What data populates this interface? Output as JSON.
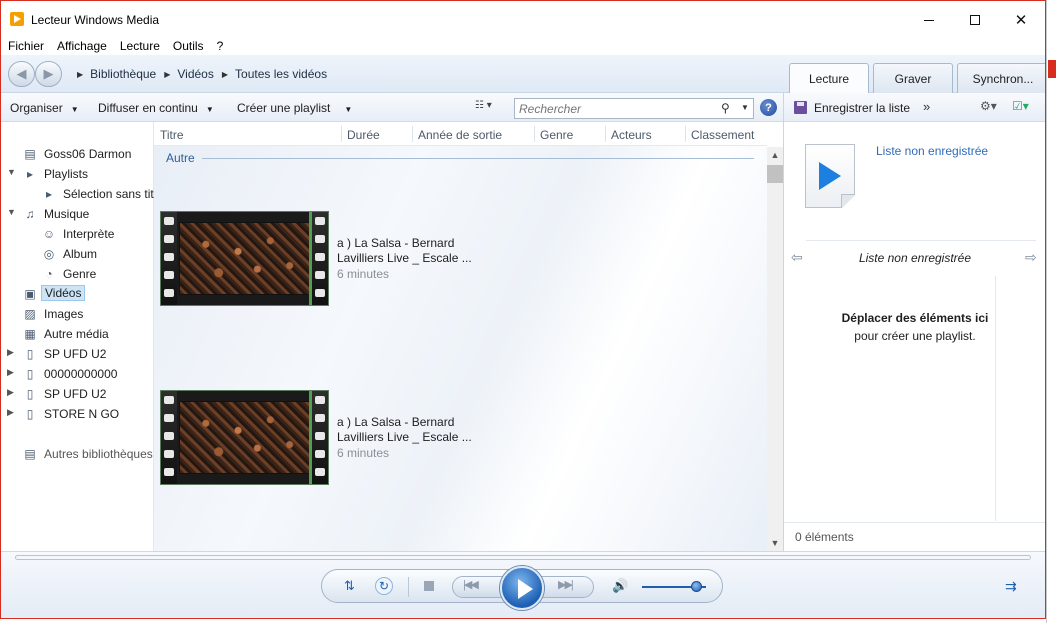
{
  "window": {
    "title": "Lecteur Windows Media",
    "min_glyph": "",
    "max_glyph": "",
    "close_glyph": "✕"
  },
  "menu": [
    "Fichier",
    "Affichage",
    "Lecture",
    "Outils",
    "?"
  ],
  "breadcrumb": [
    "Bibliothèque",
    "Vidéos",
    "Toutes les vidéos"
  ],
  "tabs": [
    "Lecture",
    "Graver",
    "Synchron..."
  ],
  "toolbar": {
    "organize": "Organiser",
    "stream": "Diffuser en continu",
    "create_playlist": "Créer une playlist",
    "search_placeholder": "Rechercher",
    "help": "?"
  },
  "nav": {
    "user": "Goss06 Darmon",
    "playlists": "Playlists",
    "playlist_item": "Sélection sans tit",
    "music": "Musique",
    "artist": "Interprète",
    "album": "Album",
    "genre": "Genre",
    "videos": "Vidéos",
    "images": "Images",
    "other_media": "Autre média",
    "devices": [
      "SP UFD U2",
      "00000000000",
      "SP UFD U2",
      "STORE N GO"
    ],
    "other_libraries": "Autres bibliothèques"
  },
  "columns": [
    "Titre",
    "Durée",
    "Année de sortie",
    "Genre",
    "Acteurs",
    "Classement"
  ],
  "group_label": "Autre",
  "videos": [
    {
      "title_line1": "a ) La Salsa - Bernard",
      "title_line2": "Lavilliers Live _ Escale ...",
      "duration": "6 minutes"
    },
    {
      "title_line1": "a ) La Salsa - Bernard",
      "title_line2": "Lavilliers Live _ Escale ...",
      "duration": "6 minutes"
    }
  ],
  "right_pane": {
    "save_list": "Enregistrer la liste",
    "more": "»",
    "unsaved_link": "Liste non enregistrée",
    "unsaved_title": "Liste non enregistrée",
    "drop_bold": "Déplacer des éléments ici",
    "drop_text": "pour créer une playlist.",
    "count": "0 éléments"
  },
  "player": {
    "volume_level": 0.85
  },
  "colors": {
    "accent": "#1f5fb0",
    "link": "#2f6bb8",
    "window_border": "#d62d20"
  }
}
